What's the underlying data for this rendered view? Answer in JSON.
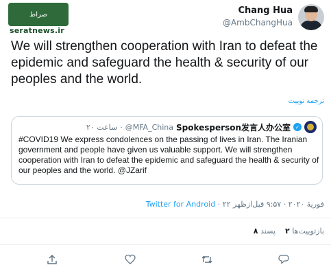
{
  "watermark": {
    "badge_text": "صراط",
    "url": "seratnews.ir"
  },
  "author": {
    "name": "Chang Hua",
    "handle": "@AmbChangHua"
  },
  "tweet": {
    "text": "We will strengthen cooperation with Iran to defeat the epidemic and safeguard the health & security of our peoples and the world."
  },
  "translate_label": "ترجمه توییت",
  "quoted": {
    "name": "Spokesperson发言人办公室",
    "handle": "@MFA_China",
    "time": "۲۰ ساعت",
    "text": "#COVID19 We express condolences on the passing of lives in Iran. The Iranian government and people have given us valuable support. We will strengthen cooperation with Iran to defeat the epidemic and safeguard the health & security of our peoples and the world. @JZarif"
  },
  "meta": {
    "time": "۹:۵۷ قبل‌ازظهر",
    "date": "۲۲ فوریهٔ ۲۰۲۰",
    "source": "Twitter for Android"
  },
  "stats": {
    "retweets_count": "۲",
    "retweets_label": "بازتوییت‌ها",
    "likes_count": "۸",
    "likes_label": "پسند"
  },
  "icons": [
    "reply-icon",
    "retweet-icon",
    "like-icon",
    "share-icon"
  ]
}
